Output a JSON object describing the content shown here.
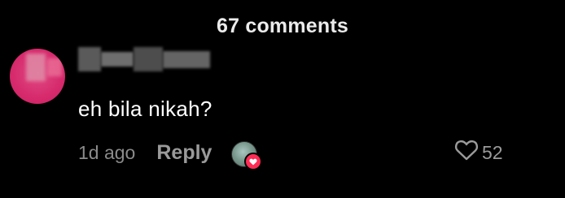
{
  "header": {
    "comments_count_label": "67 comments"
  },
  "comment": {
    "text": "eh bila nikah?",
    "time_ago": "1d ago",
    "reply_label": "Reply",
    "like_count": "52",
    "icons": {
      "like": "heart-outline-icon",
      "creator_liked_badge": "heart-icon"
    }
  },
  "colors": {
    "background": "#000000",
    "avatar": "#d62a6c",
    "badge": "#fe2c55",
    "muted_text": "#8a8a8a"
  }
}
